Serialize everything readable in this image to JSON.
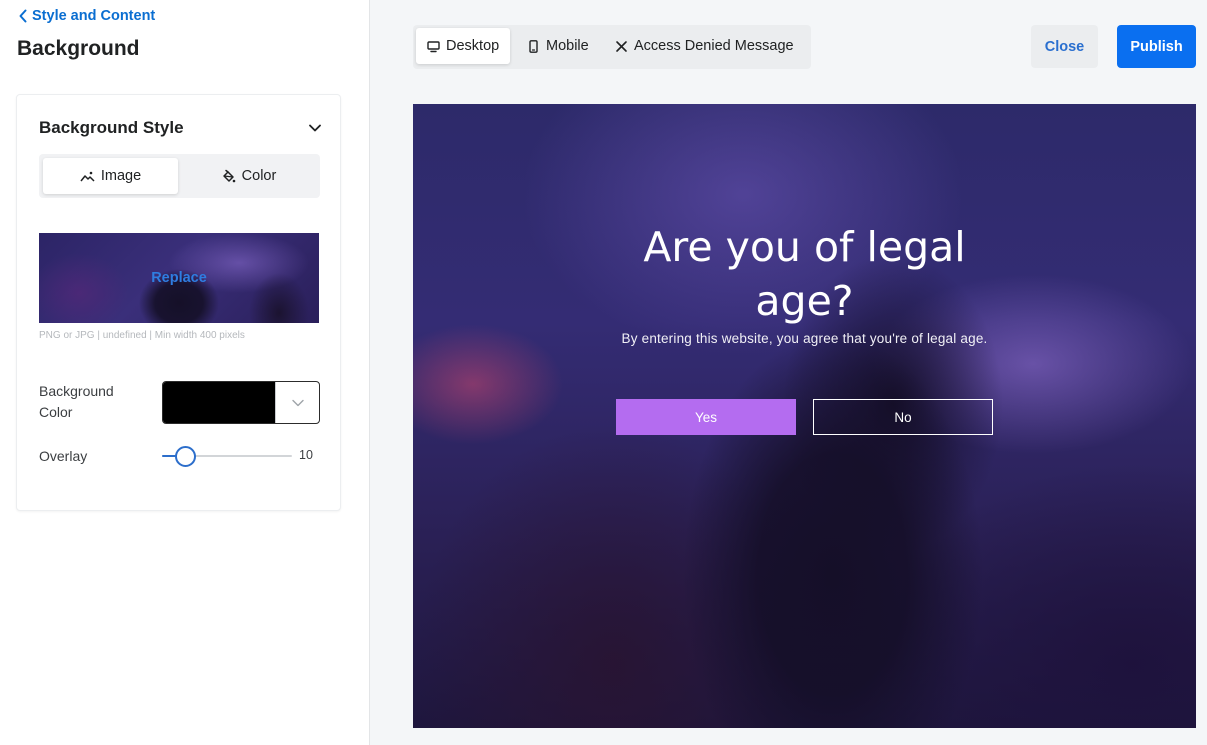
{
  "sidebar": {
    "back_label": "Style and Content",
    "title": "Background",
    "card": {
      "title": "Background Style",
      "segments": [
        {
          "label": "Image",
          "icon": "image-icon",
          "active": true
        },
        {
          "label": "Color",
          "icon": "paint-bucket-icon",
          "active": false
        }
      ],
      "image": {
        "replace_label": "Replace",
        "hint": "PNG or JPG | undefined | Min width 400 pixels"
      },
      "background_color": {
        "label": "Background Color",
        "value": "#000000"
      },
      "overlay": {
        "label": "Overlay",
        "value": 10,
        "value_text": "10",
        "max": 100
      }
    }
  },
  "topbar": {
    "tabs": [
      {
        "label": "Desktop",
        "icon": "desktop-icon",
        "active": true
      },
      {
        "label": "Mobile",
        "icon": "mobile-icon",
        "active": false
      },
      {
        "label": "Access Denied Message",
        "icon": "close-x-icon",
        "active": false
      }
    ],
    "close_label": "Close",
    "publish_label": "Publish"
  },
  "preview": {
    "title": "Are you of legal age?",
    "subtitle": "By entering this website, you agree that you're of legal age.",
    "yes_label": "Yes",
    "no_label": "No",
    "yes_color": "#b46cf0"
  },
  "colors": {
    "accent": "#0a6ff0",
    "link": "#0a6ed1"
  }
}
